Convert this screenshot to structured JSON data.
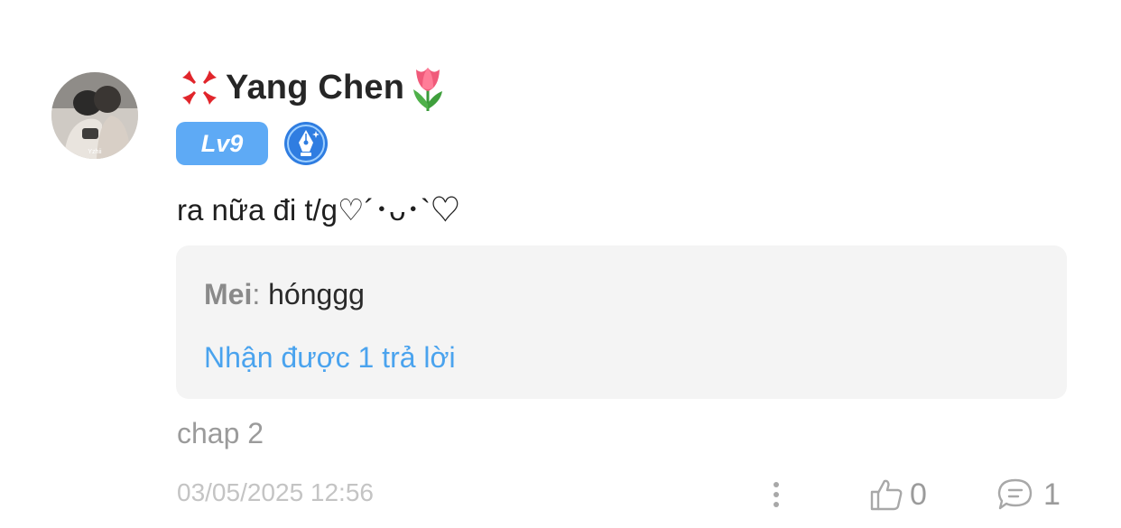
{
  "comment": {
    "user": {
      "name": "Yang Chen",
      "prefix_emoji": "anger-symbol-icon",
      "suffix_emoji": "tulip-icon",
      "level": "Lv9",
      "badge_icon": "pen-nib-badge-icon",
      "avatar_caption": "Yzhii"
    },
    "text": "ra nữa đi t/g♡´･ᴗ･`♡",
    "reply_preview": {
      "author": "Mei",
      "separator": ":",
      "content": "hónggg",
      "replies_link": "Nhận được 1 trả lời"
    },
    "chapter": "chap 2",
    "timestamp": "03/05/2025 12:56",
    "like_count": "0",
    "reply_count": "1",
    "icons": {
      "more": "more-vertical-icon",
      "like": "thumbs-up-icon",
      "reply": "comment-bubble-icon"
    },
    "colors": {
      "level_badge": "#5eaaf5",
      "link": "#4aa3ee",
      "muted": "#9b9b9b",
      "timestamp": "#c4c4c4",
      "reply_box_bg": "#f4f4f4"
    }
  }
}
